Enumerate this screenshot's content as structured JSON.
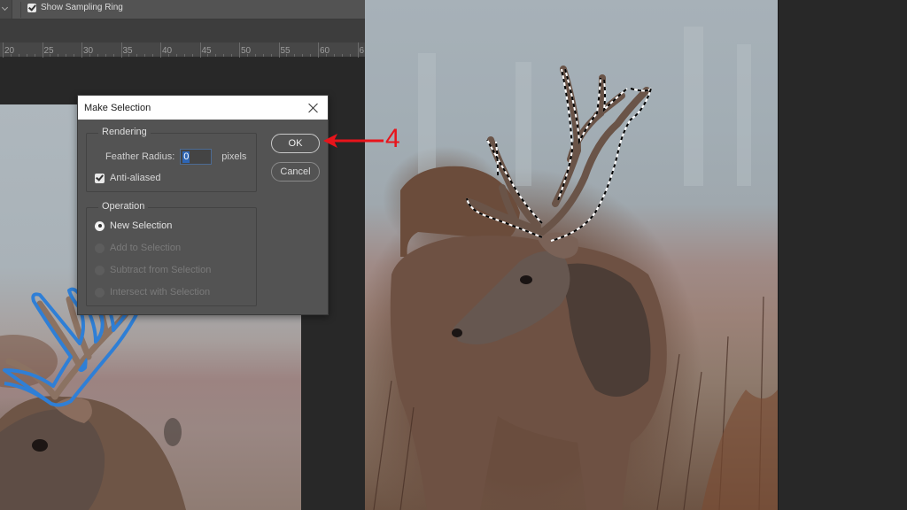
{
  "options_bar": {
    "dropdown_icon": "chevron-down-icon",
    "show_sampling_ring": {
      "label": "Show Sampling Ring",
      "checked": true
    }
  },
  "ruler": {
    "labels": [
      "20",
      "25",
      "30",
      "35",
      "40",
      "45",
      "50",
      "55",
      "60",
      "6"
    ]
  },
  "dialog": {
    "title": "Make Selection",
    "close_icon": "close-icon",
    "rendering": {
      "legend": "Rendering",
      "feather_radius_label": "Feather Radius:",
      "feather_radius_value": "0",
      "feather_radius_units": "pixels",
      "anti_aliased": {
        "label": "Anti-aliased",
        "checked": true
      }
    },
    "operation": {
      "legend": "Operation",
      "options": [
        {
          "label": "New Selection",
          "checked": true,
          "enabled": true
        },
        {
          "label": "Add to Selection",
          "checked": false,
          "enabled": false
        },
        {
          "label": "Subtract from Selection",
          "checked": false,
          "enabled": false
        },
        {
          "label": "Intersect with Selection",
          "checked": false,
          "enabled": false
        }
      ]
    },
    "buttons": {
      "ok": "OK",
      "cancel": "Cancel"
    }
  },
  "annotation": {
    "step_number": "4",
    "color": "#e8141b"
  },
  "colors": {
    "path_stroke": "#2f7fd6",
    "marching_ants": "#000000"
  }
}
